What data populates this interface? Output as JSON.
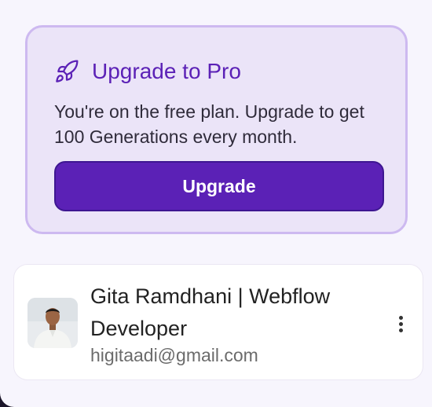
{
  "promo": {
    "title": "Upgrade to Pro",
    "description": "You're on the free plan. Upgrade to get 100 Generations every month.",
    "button_label": "Upgrade",
    "icon": "rocket-icon"
  },
  "user": {
    "name": "Gita Ramdhani | Webflow Developer",
    "email": "higitaadi@gmail.com",
    "menu_icon": "more-vertical-icon"
  },
  "colors": {
    "accent": "#5b21b6",
    "promo_bg": "#ebe4f8",
    "promo_border": "#cdb9f0",
    "panel_bg": "#f7f5fd"
  }
}
